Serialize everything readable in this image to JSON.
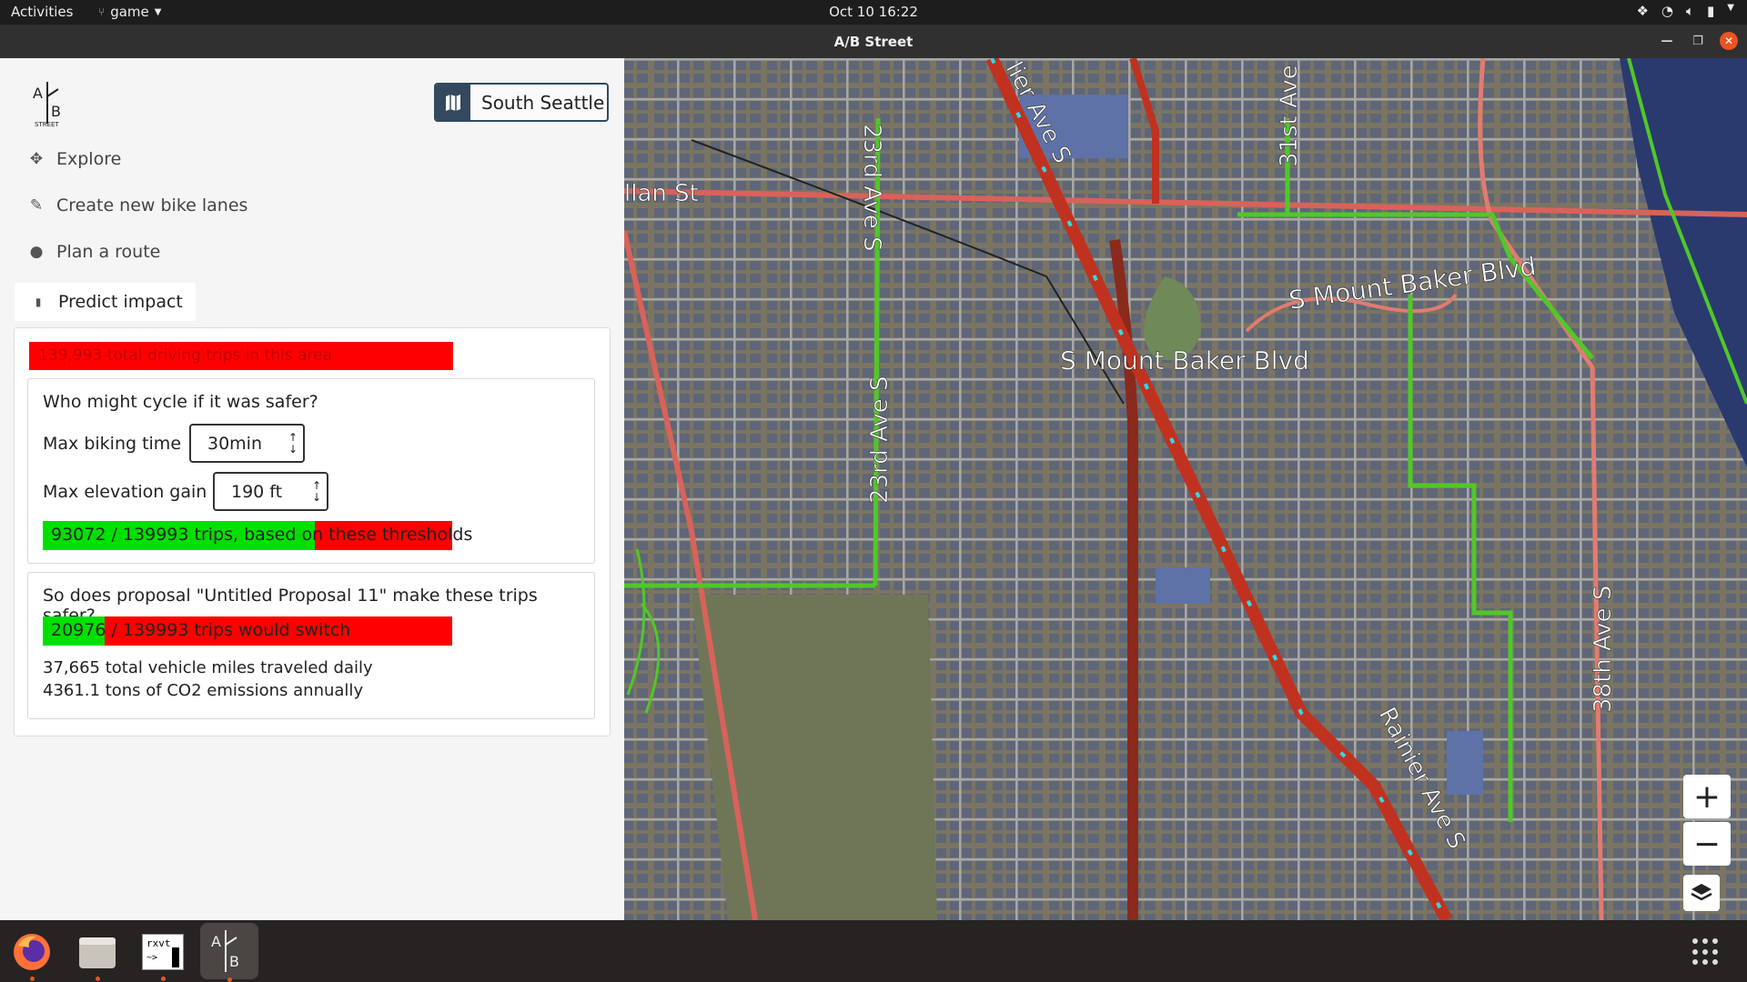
{
  "topbar": {
    "activities": "Activities",
    "app_name": "game",
    "datetime": "Oct 10  16:22"
  },
  "window": {
    "title": "A/B Street"
  },
  "panel": {
    "region_button": "South Seattle",
    "nav": {
      "explore": "Explore",
      "create_bike_lanes": "Create new bike lanes",
      "plan_route": "Plan a route",
      "predict_impact": "Predict impact"
    },
    "total_trips_text": "139,993 total driving trips in this area",
    "question1": "Who might cycle if it was safer?",
    "max_biking_time_label": "Max biking time",
    "max_biking_time_value": "30min",
    "max_elevation_label": "Max elevation gain",
    "max_elevation_value": "190 ft",
    "threshold_trips_text": "93072 / 139993 trips, based on these thresholds",
    "threshold_fraction": 0.665,
    "question2": "So does proposal \"Untitled Proposal 11\" make these trips safer?",
    "switch_trips_text": "20976 / 139993 trips would switch",
    "switch_fraction": 0.15,
    "vehicle_miles": "37,665 total vehicle miles traveled daily",
    "co2": "4361.1 tons of CO2 emissions annually"
  },
  "map": {
    "street_labels": {
      "allan_st": "llan St",
      "ave_23rd_top": "23rd Ave S",
      "ave_23rd_mid": "23rd Ave S",
      "ave_31st": "31st Ave",
      "mount_baker_1": "S Mount Baker Blvd",
      "mount_baker_2": "S Mount Baker Blvd",
      "rainier_top": "lier Ave S",
      "rainier_bottom": "Rainier Ave S",
      "ave_38th": "38th Ave S"
    },
    "zoom_in": "+",
    "zoom_out": "−"
  },
  "dock": {
    "items": [
      "firefox-icon",
      "files-icon",
      "rxvt-terminal-icon",
      "abstreet-icon"
    ],
    "rxvt_label": "rxvt"
  },
  "colors": {
    "map_bg": "#7a7463",
    "road": "#a7a7a7",
    "arterial": "#d9625a",
    "highway": "#c0321f",
    "bike_lane": "#4fc829",
    "water": "#2a3a6e",
    "park": "#6f7658"
  }
}
